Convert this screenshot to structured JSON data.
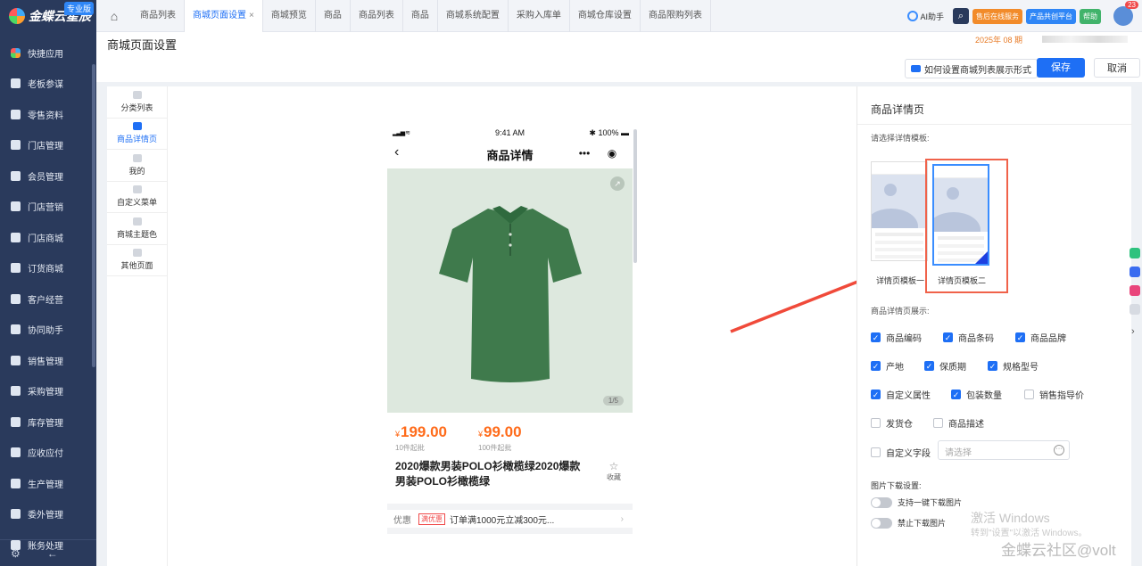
{
  "sidebar": {
    "brand": "金蝶云星辰",
    "edition": "专业版",
    "items": [
      {
        "label": "快捷应用",
        "icon": "apps-icon"
      },
      {
        "label": "老板参谋",
        "icon": "dashboard-icon"
      },
      {
        "label": "零售资料",
        "icon": "retail-icon"
      },
      {
        "label": "门店管理",
        "icon": "store-icon"
      },
      {
        "label": "会员管理",
        "icon": "member-icon"
      },
      {
        "label": "门店营销",
        "icon": "marketing-icon"
      },
      {
        "label": "门店商城",
        "icon": "mall-icon"
      },
      {
        "label": "订货商城",
        "icon": "order-mall-icon"
      },
      {
        "label": "客户经营",
        "icon": "customer-icon"
      },
      {
        "label": "协同助手",
        "icon": "collab-icon"
      },
      {
        "label": "销售管理",
        "icon": "sales-icon"
      },
      {
        "label": "采购管理",
        "icon": "purchase-icon"
      },
      {
        "label": "库存管理",
        "icon": "inventory-icon"
      },
      {
        "label": "应收应付",
        "icon": "ar-ap-icon"
      },
      {
        "label": "生产管理",
        "icon": "production-icon"
      },
      {
        "label": "委外管理",
        "icon": "outsource-icon"
      },
      {
        "label": "账务处理",
        "icon": "ledger-icon"
      }
    ]
  },
  "tabs": [
    {
      "label": "商品列表",
      "active": false
    },
    {
      "label": "商城页面设置",
      "active": true
    },
    {
      "label": "商城预览",
      "active": false
    },
    {
      "label": "商品",
      "active": false
    },
    {
      "label": "商品列表",
      "active": false
    },
    {
      "label": "商品",
      "active": false
    },
    {
      "label": "商城系统配置",
      "active": false
    },
    {
      "label": "采购入库单",
      "active": false
    },
    {
      "label": "商城仓库设置",
      "active": false
    },
    {
      "label": "商品限购列表",
      "active": false
    }
  ],
  "topbar": {
    "ai_label": "AI助手",
    "service_label": "售后在线服务",
    "cocreate_label": "产品共创平台",
    "help_label": "帮助",
    "badge_count": "23",
    "colors": {
      "service": "#f28b2a",
      "cocreate": "#2f86f6",
      "help": "#41b36b"
    }
  },
  "header": {
    "title": "商城页面设置",
    "date": "2025年 08 期",
    "help_link": "如何设置商城列表展示形式",
    "save": "保存",
    "cancel": "取消"
  },
  "leftnav": [
    {
      "label": "分类列表",
      "active": false
    },
    {
      "label": "商品详情页",
      "active": true
    },
    {
      "label": "我的",
      "active": false
    },
    {
      "label": "自定义菜单",
      "active": false
    },
    {
      "label": "商城主题色",
      "active": false
    },
    {
      "label": "其他页面",
      "active": false
    }
  ],
  "phone": {
    "time": "9:41 AM",
    "battery": "100%",
    "title": "商品详情",
    "image_counter": "1/5",
    "prices": [
      {
        "currency": "¥",
        "value": "199.00",
        "moq": "10件起批"
      },
      {
        "currency": "¥",
        "value": "99.00",
        "moq": "100件起批"
      }
    ],
    "product_name": "2020爆款男装POLO衫橄榄绿2020爆款男装POLO衫橄榄绿",
    "fav_label": "收藏",
    "promo_label": "优惠",
    "promo_tag": "满优惠",
    "promo_text": "订单满1000元立减300元..."
  },
  "panel": {
    "title": "商品详情页",
    "select_hint": "请选择详情模板:",
    "templates": [
      {
        "label": "详情页模板一",
        "selected": false
      },
      {
        "label": "详情页模板二",
        "selected": true
      }
    ],
    "display_section": "商品详情页展示:",
    "options": [
      {
        "label": "商品编码",
        "checked": true
      },
      {
        "label": "商品条码",
        "checked": true
      },
      {
        "label": "商品品牌",
        "checked": true
      },
      {
        "label": "产地",
        "checked": true
      },
      {
        "label": "保质期",
        "checked": true
      },
      {
        "label": "规格型号",
        "checked": true
      },
      {
        "label": "自定义属性",
        "checked": true
      },
      {
        "label": "包装数量",
        "checked": true
      },
      {
        "label": "销售指导价",
        "checked": false
      },
      {
        "label": "发货仓",
        "checked": false
      },
      {
        "label": "商品描述",
        "checked": false
      },
      {
        "label": "自定义字段",
        "checked": false
      }
    ],
    "custom_field_placeholder": "请选择",
    "image_section": "图片下载设置:",
    "toggles": [
      {
        "label": "支持一键下载图片",
        "on": false
      },
      {
        "label": "禁止下载图片",
        "on": false
      }
    ]
  },
  "overlay": {
    "activate_title": "激活 Windows",
    "activate_sub": "转到\"设置\"以激活 Windows。",
    "watermark": "金蝶云社区@volt"
  }
}
